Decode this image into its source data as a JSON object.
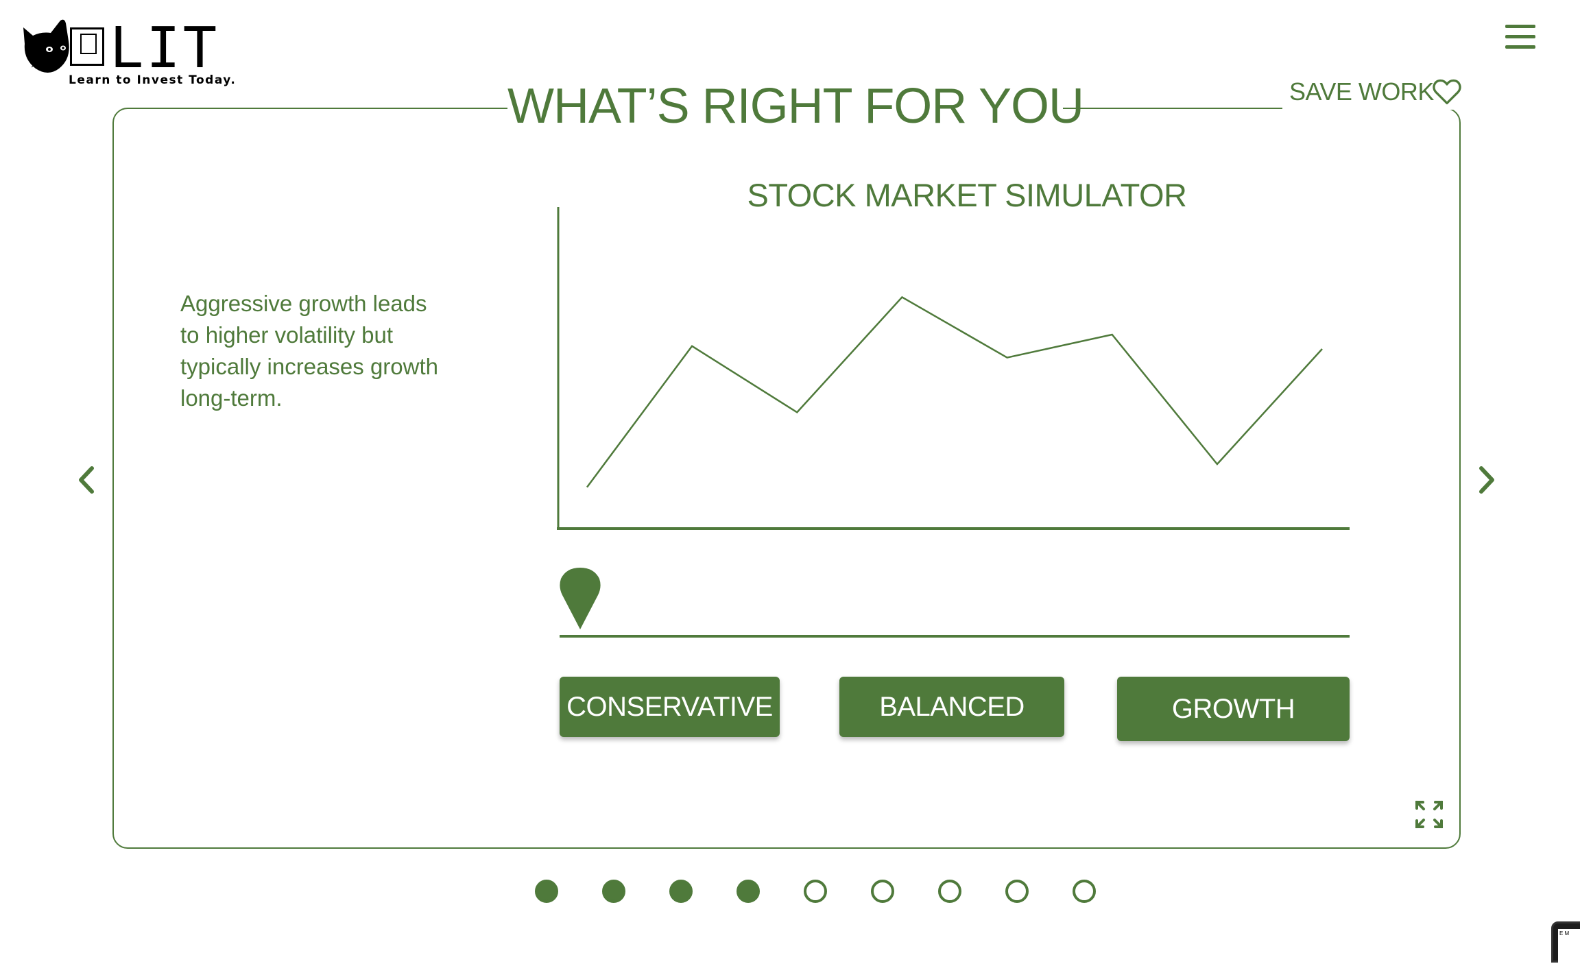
{
  "brand": {
    "name": "LIT",
    "tagline": "Learn to Invest Today."
  },
  "header": {
    "title": "WHAT’S RIGHT FOR YOU",
    "save_label": "SAVE WORK",
    "menu_icon": "hamburger-icon",
    "save_icon": "heart-icon"
  },
  "description": "Aggressive growth leads to higher volatility but typically increases growth long-term.",
  "chart_data": {
    "type": "line",
    "title": "STOCK MARKET SIMULATOR",
    "xlabel": "",
    "ylabel": "",
    "grid": false,
    "series": [
      {
        "values": [
          0.07,
          0.56,
          0.33,
          0.73,
          0.52,
          0.6,
          0.15,
          0.55
        ]
      }
    ],
    "x": [
      0,
      1,
      2,
      3,
      4,
      5,
      6,
      7
    ],
    "ylim": [
      0,
      1
    ]
  },
  "slider": {
    "value": 0
  },
  "options": {
    "conservative": "CONSERVATIVE",
    "balanced": "BALANCED",
    "growth": "GROWTH"
  },
  "pagination": {
    "total": 9,
    "completed": 4
  },
  "colors": {
    "accent": "#4f7a3b",
    "background": "#ffffff",
    "button_text": "#ffffff"
  },
  "corner_widget": {
    "text": "E M"
  }
}
